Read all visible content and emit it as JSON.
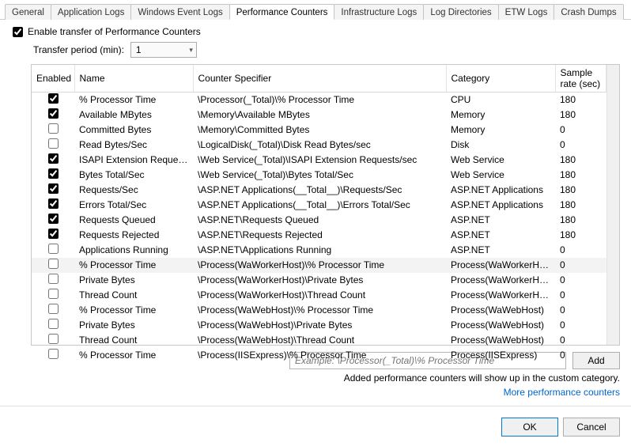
{
  "tabs": [
    {
      "label": "General"
    },
    {
      "label": "Application Logs"
    },
    {
      "label": "Windows Event Logs"
    },
    {
      "label": "Performance Counters"
    },
    {
      "label": "Infrastructure Logs"
    },
    {
      "label": "Log Directories"
    },
    {
      "label": "ETW Logs"
    },
    {
      "label": "Crash Dumps"
    }
  ],
  "active_tab_index": 3,
  "enable_transfer_label": "Enable transfer of Performance Counters",
  "enable_transfer_checked": true,
  "transfer_period_label": "Transfer period (min):",
  "transfer_period_value": "1",
  "columns": {
    "enabled": "Enabled",
    "name": "Name",
    "specifier": "Counter Specifier",
    "category": "Category",
    "rate": "Sample rate (sec)"
  },
  "rows": [
    {
      "enabled": true,
      "name": "% Processor Time",
      "spec": "\\Processor(_Total)\\% Processor Time",
      "cat": "CPU",
      "rate": "180"
    },
    {
      "enabled": true,
      "name": "Available MBytes",
      "spec": "\\Memory\\Available MBytes",
      "cat": "Memory",
      "rate": "180"
    },
    {
      "enabled": false,
      "name": "Committed Bytes",
      "spec": "\\Memory\\Committed Bytes",
      "cat": "Memory",
      "rate": "0"
    },
    {
      "enabled": false,
      "name": "Read Bytes/Sec",
      "spec": "\\LogicalDisk(_Total)\\Disk Read Bytes/sec",
      "cat": "Disk",
      "rate": "0"
    },
    {
      "enabled": true,
      "name": "ISAPI Extension Requests/...",
      "spec": "\\Web Service(_Total)\\ISAPI Extension Requests/sec",
      "cat": "Web Service",
      "rate": "180"
    },
    {
      "enabled": true,
      "name": "Bytes Total/Sec",
      "spec": "\\Web Service(_Total)\\Bytes Total/Sec",
      "cat": "Web Service",
      "rate": "180"
    },
    {
      "enabled": true,
      "name": "Requests/Sec",
      "spec": "\\ASP.NET Applications(__Total__)\\Requests/Sec",
      "cat": "ASP.NET Applications",
      "rate": "180"
    },
    {
      "enabled": true,
      "name": "Errors Total/Sec",
      "spec": "\\ASP.NET Applications(__Total__)\\Errors Total/Sec",
      "cat": "ASP.NET Applications",
      "rate": "180"
    },
    {
      "enabled": true,
      "name": "Requests Queued",
      "spec": "\\ASP.NET\\Requests Queued",
      "cat": "ASP.NET",
      "rate": "180"
    },
    {
      "enabled": true,
      "name": "Requests Rejected",
      "spec": "\\ASP.NET\\Requests Rejected",
      "cat": "ASP.NET",
      "rate": "180"
    },
    {
      "enabled": false,
      "name": "Applications Running",
      "spec": "\\ASP.NET\\Applications Running",
      "cat": "ASP.NET",
      "rate": "0"
    },
    {
      "enabled": false,
      "name": "% Processor Time",
      "spec": "\\Process(WaWorkerHost)\\% Processor Time",
      "cat": "Process(WaWorkerHost)",
      "rate": "0",
      "highlight": true
    },
    {
      "enabled": false,
      "name": "Private Bytes",
      "spec": "\\Process(WaWorkerHost)\\Private Bytes",
      "cat": "Process(WaWorkerHost)",
      "rate": "0"
    },
    {
      "enabled": false,
      "name": "Thread Count",
      "spec": "\\Process(WaWorkerHost)\\Thread Count",
      "cat": "Process(WaWorkerHost)",
      "rate": "0"
    },
    {
      "enabled": false,
      "name": "% Processor Time",
      "spec": "\\Process(WaWebHost)\\% Processor Time",
      "cat": "Process(WaWebHost)",
      "rate": "0"
    },
    {
      "enabled": false,
      "name": "Private Bytes",
      "spec": "\\Process(WaWebHost)\\Private Bytes",
      "cat": "Process(WaWebHost)",
      "rate": "0"
    },
    {
      "enabled": false,
      "name": "Thread Count",
      "spec": "\\Process(WaWebHost)\\Thread Count",
      "cat": "Process(WaWebHost)",
      "rate": "0"
    },
    {
      "enabled": false,
      "name": "% Processor Time",
      "spec": "\\Process(IISExpress)\\% Processor Time",
      "cat": "Process(IISExpress)",
      "rate": "0"
    }
  ],
  "add_placeholder": "Example: \\Processor(_Total)\\% Processor Time",
  "add_button": "Add",
  "hint_text": "Added performance counters will show up in the custom category.",
  "link_text": "More performance counters",
  "ok_button": "OK",
  "cancel_button": "Cancel"
}
